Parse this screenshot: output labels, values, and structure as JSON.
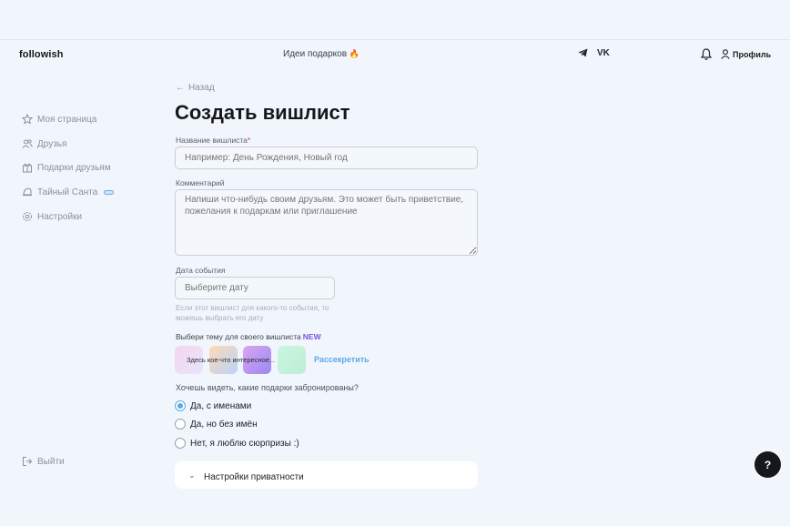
{
  "header": {
    "logo": "followish",
    "gifts_link": "Идеи подарков",
    "telegram": "✈",
    "vk": "VK",
    "profile_label": "Профиль"
  },
  "sidebar": {
    "items": [
      {
        "label": "Моя страница",
        "icon": "star-icon"
      },
      {
        "label": "Друзья",
        "icon": "users-icon"
      },
      {
        "label": "Подарки друзьям",
        "icon": "gift-icon"
      },
      {
        "label": "Тайный Санта",
        "icon": "santa-icon"
      },
      {
        "label": "Настройки",
        "icon": "gear-icon"
      }
    ],
    "logout_label": "Выйти"
  },
  "form": {
    "back_label": "Назад",
    "title": "Создать вишлист",
    "name_label": "Название вишлиста",
    "name_required": "*",
    "name_placeholder": "Например: День Рождения, Новый год",
    "comment_label": "Комментарий",
    "comment_placeholder": "Напиши что-нибудь своим друзьям. Это может быть приветствие, пожелания к подаркам или приглашение",
    "date_label": "Дата события",
    "date_placeholder": "Выберите дату",
    "date_hint": "Если этот вишлист для какого-то события, то можешь выбрать его дату",
    "theme_label": "Выбери тему для своего вишлиста",
    "theme_new": "NEW",
    "theme_teaser": "Здесь кое-что интересное...",
    "theme_discover": "Рассекретить",
    "reserve_question": "Хочешь видеть, какие подарки забронированы?",
    "reserve_options": [
      {
        "label": "Да, с именами",
        "checked": true
      },
      {
        "label": "Да, но без имён",
        "checked": false
      },
      {
        "label": "Нет, я люблю сюрпризы :)",
        "checked": false
      }
    ],
    "privacy_label": "Настройки приватности"
  },
  "help_button": "?",
  "colors": {
    "background": "#f1f6fc",
    "accent_blue": "#59a9e6",
    "new_badge": "#7b53e4",
    "required": "#e0344b"
  }
}
